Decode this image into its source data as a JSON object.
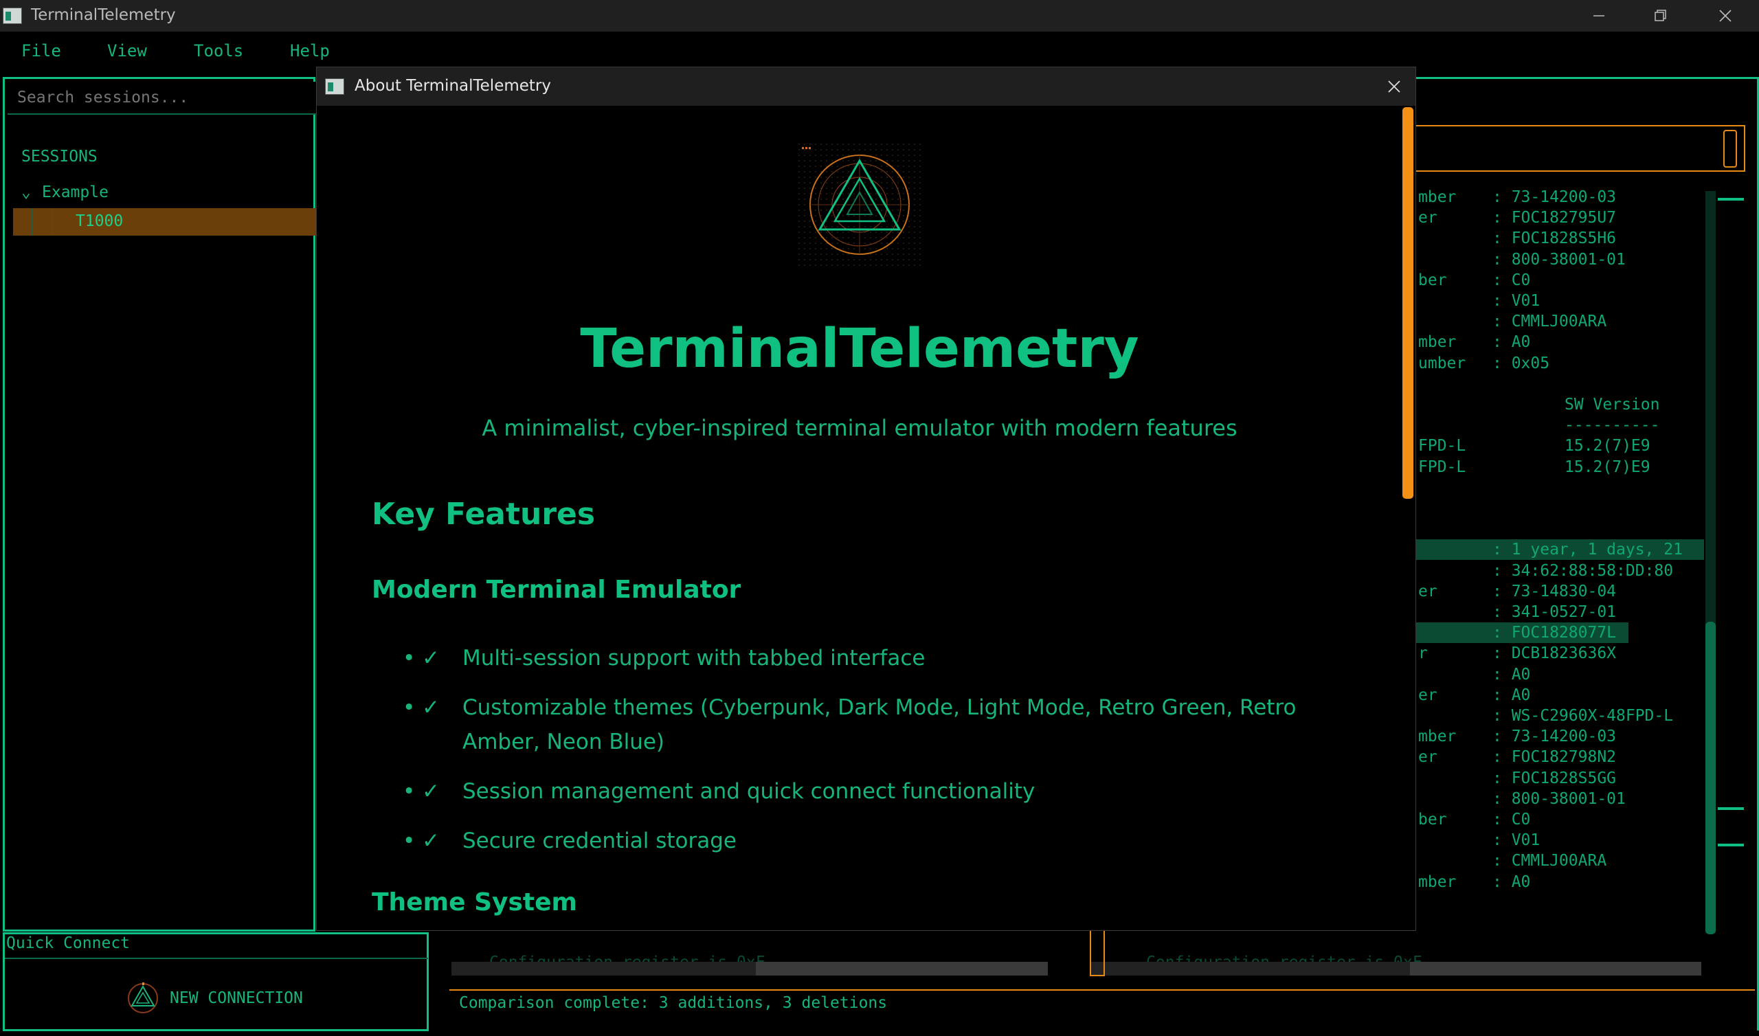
{
  "window": {
    "title": "TerminalTelemetry"
  },
  "menu": [
    "File",
    "View",
    "Tools",
    "Help"
  ],
  "sidebar": {
    "search_placeholder": "Search sessions...",
    "sessions_label": "SESSIONS",
    "folder": "Example",
    "session": "T1000"
  },
  "quick_connect": {
    "label": "Quick Connect",
    "button": "NEW CONNECTION"
  },
  "terminal": {
    "lines": [
      {
        "l": "mber",
        "v": ": 73-14200-03"
      },
      {
        "l": "er",
        "v": ": FOC182795U7"
      },
      {
        "l": "",
        "v": ": FOC1828S5H6"
      },
      {
        "l": "",
        "v": ": 800-38001-01"
      },
      {
        "l": "ber",
        "v": ": C0"
      },
      {
        "l": "",
        "v": ": V01"
      },
      {
        "l": "",
        "v": ": CMMLJ00ARA"
      },
      {
        "l": "mber",
        "v": ": A0"
      },
      {
        "l": "umber",
        "v": ": 0x05"
      },
      {
        "l": "",
        "v": ""
      },
      {
        "l": "",
        "v": "SW Version"
      },
      {
        "l": "",
        "v": "----------"
      },
      {
        "l": "FPD-L",
        "v": "15.2(7)E9"
      },
      {
        "l": "FPD-L",
        "v": "15.2(7)E9"
      },
      {
        "l": "",
        "v": ""
      },
      {
        "l": "",
        "v": ""
      },
      {
        "l": "",
        "v": ""
      },
      {
        "l": "",
        "v": ": 1 year, 1 days, 21"
      },
      {
        "l": "",
        "v": ": 34:62:88:58:DD:80"
      },
      {
        "l": "er",
        "v": ": 73-14830-04"
      },
      {
        "l": "",
        "v": ": 341-0527-01"
      },
      {
        "l": "",
        "v": ": FOC1828077L"
      },
      {
        "l": "r",
        "v": ": DCB1823636X"
      },
      {
        "l": "",
        "v": ": A0"
      },
      {
        "l": "er",
        "v": ": A0"
      },
      {
        "l": "",
        "v": ": WS-C2960X-48FPD-L"
      },
      {
        "l": "mber",
        "v": ": 73-14200-03"
      },
      {
        "l": "er",
        "v": ": FOC182798N2"
      },
      {
        "l": "",
        "v": ": FOC1828S5GG"
      },
      {
        "l": "",
        "v": ": 800-38001-01"
      },
      {
        "l": "ber",
        "v": ": C0"
      },
      {
        "l": "",
        "v": ": V01"
      },
      {
        "l": "",
        "v": ": CMMLJ00ARA"
      },
      {
        "l": "mber",
        "v": ": A0"
      }
    ]
  },
  "compare": {
    "status": "Comparison complete: 3 additions, 3 deletions",
    "ghost_left": "Configuration register is 0xF",
    "ghost_right": "Configuration register is 0xF"
  },
  "about": {
    "dialog_title": "About TerminalTelemetry",
    "app_name": "TerminalTelemetry",
    "tagline": "A minimalist, cyber-inspired terminal emulator with modern features",
    "key_features_heading": "Key Features",
    "section1_heading": "Modern Terminal Emulator",
    "bullet": "•",
    "check": "✓",
    "features": [
      "Multi-session support with tabbed interface",
      "Customizable themes (Cyberpunk, Dark Mode, Light Mode, Retro Green, Retro Amber, Neon Blue)",
      "Session management and quick connect functionality",
      "Secure credential storage"
    ],
    "section2_heading": "Theme System"
  },
  "colors": {
    "accent": "#10c080",
    "border": "#0fbf86",
    "warning": "#e88a18",
    "scroll_thumb": "#f39016",
    "highlight": "#6b3f0a"
  }
}
